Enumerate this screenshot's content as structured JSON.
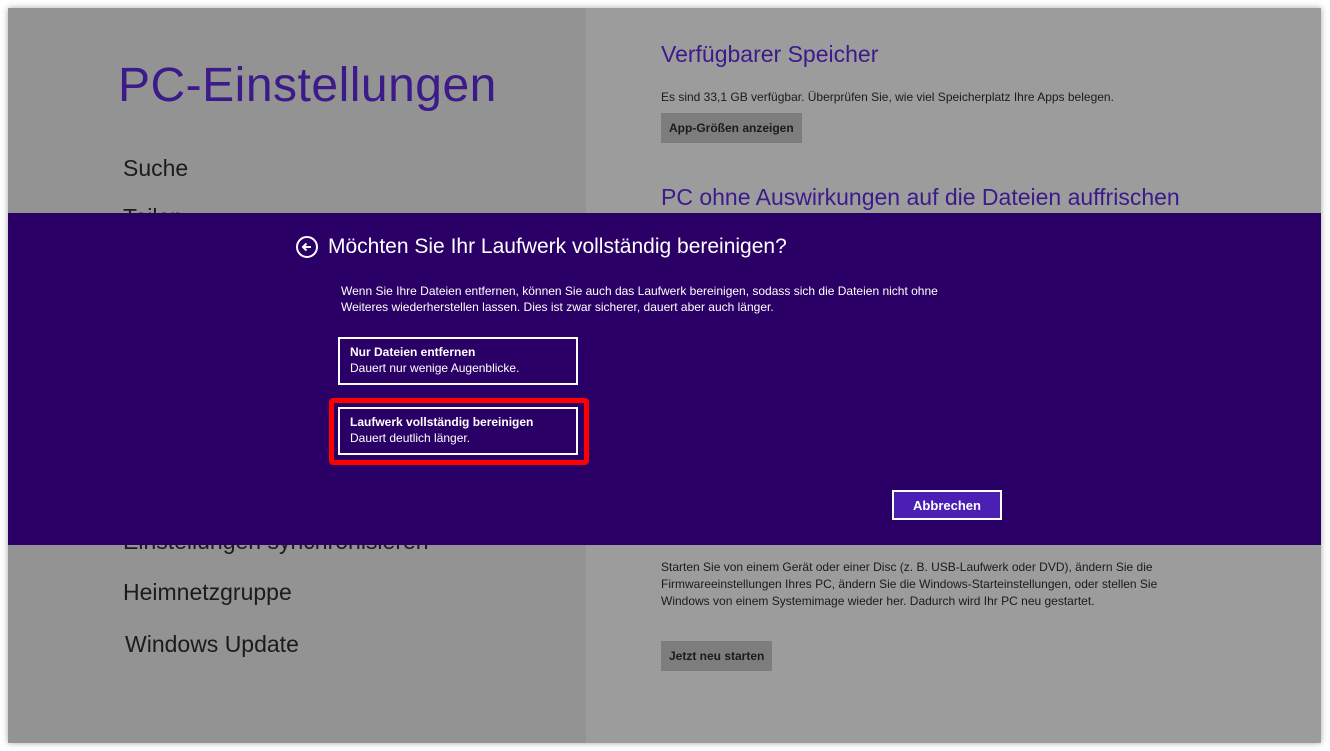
{
  "left": {
    "title": "PC-Einstellungen",
    "nav_visible": [
      {
        "label": "Suche"
      },
      {
        "label": "Teilen"
      },
      {
        "label": "Einstellungen synchronisieren"
      },
      {
        "label": "Heimnetzgruppe"
      },
      {
        "label": "Windows Update"
      }
    ]
  },
  "right": {
    "storage": {
      "heading": "Verfügbarer Speicher",
      "text": "Es sind 33,1 GB verfügbar. Überprüfen Sie, wie viel Speicherplatz Ihre Apps belegen.",
      "button": "App-Größen anzeigen"
    },
    "refresh": {
      "heading": "PC ohne Auswirkungen auf die Dateien auffrischen"
    },
    "advanced": {
      "text": "Starten Sie von einem Gerät oder einer Disc (z. B. USB-Laufwerk oder DVD), ändern Sie die Firmwareeinstellungen Ihres PC, ändern Sie die Windows-Starteinstellungen, oder stellen Sie Windows von einem Systemimage wieder her. Dadurch wird Ihr PC neu gestartet.",
      "button": "Jetzt neu starten"
    }
  },
  "dialog": {
    "title": "Möchten Sie Ihr Laufwerk vollständig bereinigen?",
    "description": "Wenn Sie Ihre Dateien entfernen, können Sie auch das Laufwerk bereinigen, sodass sich die Dateien nicht ohne Weiteres wiederherstellen lassen. Dies ist zwar sicherer, dauert aber auch länger.",
    "option1": {
      "title": "Nur Dateien entfernen",
      "subtitle": "Dauert nur wenige Augenblicke."
    },
    "option2": {
      "title": "Laufwerk vollständig bereinigen",
      "subtitle": "Dauert deutlich länger."
    },
    "cancel": "Abbrechen"
  },
  "colors": {
    "accent_purple": "#3c1a8a",
    "dialog_background": "#2a0066",
    "highlight_red": "#ff0000",
    "cancel_button": "#4b1fb3"
  }
}
